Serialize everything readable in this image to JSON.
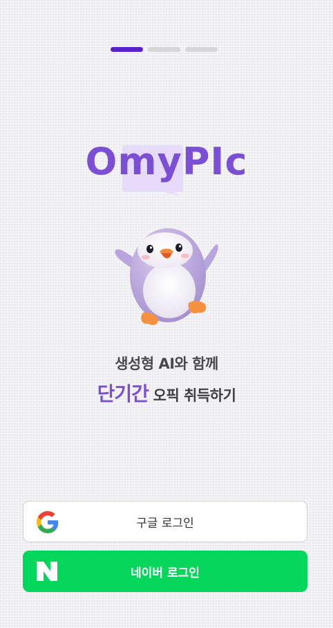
{
  "onboarding": {
    "page_count": 3,
    "active_page": 1
  },
  "brand": {
    "logo_text": "OmyPIc",
    "logo_color": "#7b4fd4"
  },
  "tagline": {
    "line1": "생성형 AI와 함께",
    "line2_accent": "단기간",
    "line2_rest": " 오픽 취득하기"
  },
  "buttons": {
    "google": {
      "label": "구글 로그인",
      "icon": "google-icon"
    },
    "naver": {
      "label": "네이버 로그인",
      "icon": "naver-icon",
      "color": "#03d65b"
    }
  }
}
